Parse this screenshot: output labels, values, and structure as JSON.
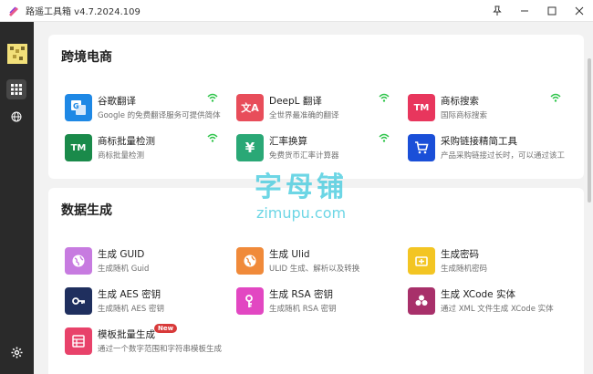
{
  "window": {
    "title": "路遥工具箱 v4.7.2024.109"
  },
  "sidebar": {
    "items": [
      {
        "name": "apps-grid-icon",
        "active": true
      },
      {
        "name": "globe-icon",
        "active": false
      }
    ],
    "bottom": {
      "name": "gear-icon"
    }
  },
  "sections": [
    {
      "title": "跨境电商",
      "tools": [
        {
          "name": "谷歌翻译",
          "desc": "Google 的免费翻译服务可提供简体",
          "icon": "translate-icon",
          "icon_text": "G",
          "color": "#1e88e5",
          "wifi": true
        },
        {
          "name": "DeepL 翻译",
          "desc": "全世界最准确的翻译",
          "icon": "translate-icon",
          "icon_text": "文A",
          "color": "#e84d5a",
          "wifi": true
        },
        {
          "name": "商标搜索",
          "desc": "国际商标搜索",
          "icon": "trademark-icon",
          "icon_text": "TM",
          "color": "#e8365d",
          "wifi": true
        },
        {
          "name": "商标批量检测",
          "desc": "商标批量检测",
          "icon": "trademark-icon",
          "icon_text": "TM",
          "color": "#1a8a4a",
          "wifi": true
        },
        {
          "name": "汇率换算",
          "desc": "免费货币汇率计算器",
          "icon": "yen-icon",
          "icon_text": "¥",
          "color": "#2aa876",
          "wifi": true
        },
        {
          "name": "采购链接精简工具",
          "desc": "产品采购链接过长时，可以通过该工",
          "icon": "cart-icon",
          "icon_text": "🛒",
          "color": "#1a4fd8",
          "wifi": false
        }
      ]
    },
    {
      "title": "数据生成",
      "tools": [
        {
          "name": "生成 GUID",
          "desc": "生成随机 Guid",
          "icon": "globe-icon",
          "icon_text": "◍",
          "color": "#c77be0",
          "wifi": false,
          "badge": ""
        },
        {
          "name": "生成 Ulid",
          "desc": "ULID 生成、解析以及转换",
          "icon": "globe-icon",
          "icon_text": "◍",
          "color": "#f08a3a",
          "wifi": false,
          "badge": ""
        },
        {
          "name": "生成密码",
          "desc": "生成随机密码",
          "icon": "password-icon",
          "icon_text": "▣",
          "color": "#f3c523",
          "wifi": false,
          "badge": ""
        },
        {
          "name": "生成 AES 密钥",
          "desc": "生成随机 AES 密钥",
          "icon": "key-icon",
          "icon_text": "⚷",
          "color": "#1f2f5e",
          "wifi": false,
          "badge": ""
        },
        {
          "name": "生成 RSA 密钥",
          "desc": "生成随机 RSA 密钥",
          "icon": "key-icon",
          "icon_text": "⚷",
          "color": "#e247c2",
          "wifi": false,
          "badge": ""
        },
        {
          "name": "生成 XCode 实体",
          "desc": "通过 XML 文件生成 XCode 实体",
          "icon": "puzzle-icon",
          "icon_text": "✤",
          "color": "#a8306a",
          "wifi": false,
          "badge": ""
        },
        {
          "name": "模板批量生成",
          "desc": "通过一个数字范围和字符串模板生成",
          "icon": "template-icon",
          "icon_text": "☰",
          "color": "#e8426a",
          "wifi": false,
          "badge": "New"
        }
      ]
    }
  ],
  "watermark": {
    "line1": "字母铺",
    "line2": "zimupu.com"
  }
}
